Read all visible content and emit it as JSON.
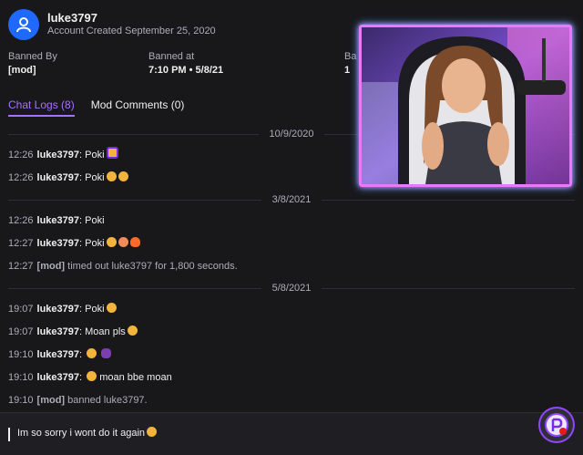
{
  "user": {
    "username": "luke3797",
    "created": "Account Created September 25, 2020",
    "avatar_icon": "user-icon",
    "avatar_color": "#1f69ff"
  },
  "ban": {
    "banned_by_label": "Banned By",
    "banned_by_value": "[mod]",
    "banned_at_label": "Banned at",
    "banned_at_value": "7:10 PM • 5/8/21",
    "third_label": "Ba",
    "third_value": "1"
  },
  "tabs": [
    {
      "label": "Chat Logs (8)",
      "active": true
    },
    {
      "label": "Mod Comments (0)",
      "active": false
    }
  ],
  "log": {
    "groups": [
      {
        "date": "10/9/2020",
        "lines": [
          {
            "time": "12:26",
            "user": "luke3797",
            "text": "Poki"
          },
          {
            "time": "12:26",
            "user": "luke3797",
            "text": "Poki"
          }
        ]
      },
      {
        "date": "3/8/2021",
        "lines": [
          {
            "time": "12:26",
            "user": "luke3797",
            "text": "Poki"
          },
          {
            "time": "12:27",
            "user": "luke3797",
            "text": "Poki"
          },
          {
            "time": "12:27",
            "mod_tag": "[mod]",
            "text": "timed out luke3797 for 1,800 seconds."
          }
        ]
      },
      {
        "date": "5/8/2021",
        "lines": [
          {
            "time": "19:07",
            "user": "luke3797",
            "text": "Poki"
          },
          {
            "time": "19:07",
            "user": "luke3797",
            "text": "Moan pls"
          },
          {
            "time": "19:10",
            "user": "luke3797",
            "text": ""
          },
          {
            "time": "19:10",
            "user": "luke3797",
            "text": "moan bbe moan"
          },
          {
            "time": "19:10",
            "mod_tag": "[mod]",
            "text": "banned luke3797."
          }
        ]
      }
    ]
  },
  "reply": {
    "text": "Im so sorry i wont do it again"
  },
  "colors": {
    "accent": "#a970ff",
    "background": "#18181b",
    "webcam_border": "#e879f9"
  }
}
